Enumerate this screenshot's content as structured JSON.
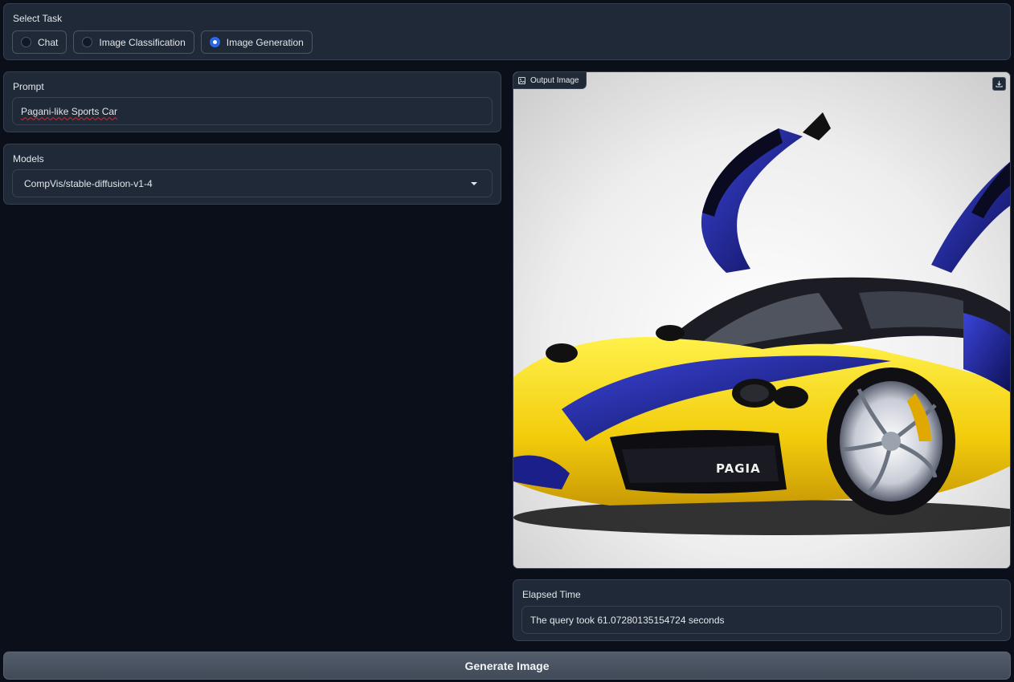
{
  "task": {
    "label": "Select Task",
    "options": [
      {
        "label": "Chat",
        "selected": false
      },
      {
        "label": "Image Classification",
        "selected": false
      },
      {
        "label": "Image Generation",
        "selected": true
      }
    ]
  },
  "prompt": {
    "label": "Prompt",
    "value": "Pagani-like Sports Car"
  },
  "models": {
    "label": "Models",
    "selected": "CompVis/stable-diffusion-v1-4"
  },
  "output": {
    "label": "Output Image",
    "icon": "image-icon",
    "download_icon": "download-icon",
    "plate_text": "PAGIA"
  },
  "elapsed": {
    "label": "Elapsed Time",
    "value": "The query took 61.07280135154724 seconds"
  },
  "generate": {
    "label": "Generate Image"
  },
  "colors": {
    "background": "#0b0f19",
    "panel": "#1f2937",
    "accent": "#2563eb",
    "car_yellow": "#f5d20f",
    "car_blue": "#1b1f8a"
  }
}
